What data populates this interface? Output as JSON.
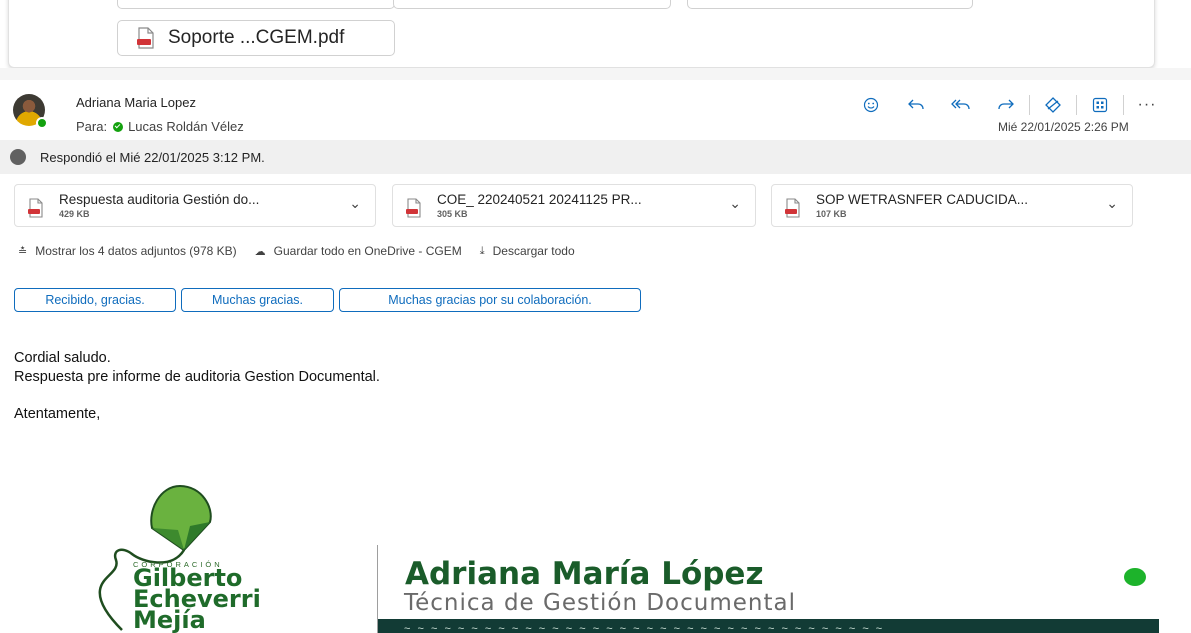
{
  "previous_message": {
    "attachment_label": "Soporte ...CGEM.pdf"
  },
  "header": {
    "sender_name": "Adriana Maria Lopez",
    "to_label": "Para:",
    "recipient": "Lucas Roldán Vélez",
    "date": "Mié 22/01/2025 2:26 PM",
    "actions": [
      "emoji-icon",
      "reply-icon",
      "reply-all-icon",
      "forward-icon",
      "sensitivity-icon",
      "apps-icon",
      "more-icon"
    ],
    "accent_color": "#0f6cbd"
  },
  "replied_notice": "Respondió el Mié 22/01/2025 3:12 PM.",
  "attachments": [
    {
      "name": "Respuesta auditoria Gestión do...",
      "size": "429 KB"
    },
    {
      "name": "COE_ 220240521 20241125 PR...",
      "size": "305 KB"
    },
    {
      "name": "SOP WETRASNFER CADUCIDA...",
      "size": "107 KB"
    }
  ],
  "attachment_links": {
    "show_all": "Mostrar los 4 datos adjuntos (978 KB)",
    "save_onedrive": "Guardar todo en OneDrive - CGEM",
    "download_all": "Descargar todo"
  },
  "quick_replies": [
    "Recibido, gracias.",
    "Muchas gracias.",
    "Muchas gracias por su colaboración."
  ],
  "body": {
    "line1": "Cordial saludo.",
    "line2": "Respuesta pre informe de auditoria Gestion Documental.",
    "closing": "Atentamente,"
  },
  "signature": {
    "org_small": "CORPORACIÓN",
    "org_line1": "Gilberto",
    "org_line2": "Echeverri",
    "org_line3": "Mejía",
    "name": "Adriana María López",
    "title": "Técnica de Gestión Documental",
    "brand_color": "#1a5c2a"
  }
}
